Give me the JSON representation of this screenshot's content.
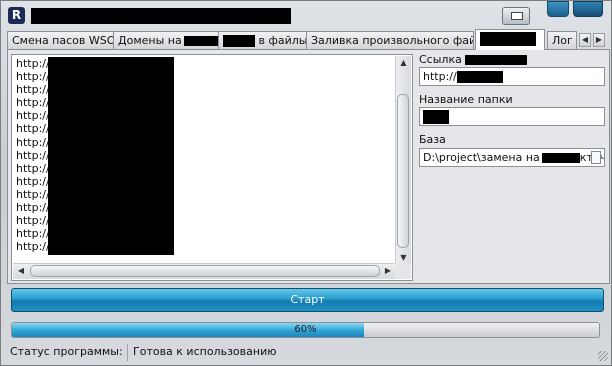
{
  "app": {
    "title": ""
  },
  "tabs": [
    {
      "label": "Смена пасов  WSO"
    },
    {
      "label": "Домены на"
    },
    {
      "label": " в файлы"
    },
    {
      "label": "Заливка произвольного файла"
    },
    {
      "label": ""
    },
    {
      "label": "Лог"
    }
  ],
  "url_list": {
    "lines": [
      "http://",
      "http://",
      "http://",
      "http://",
      "http://",
      "http://",
      "http://",
      "http://",
      "http://",
      "http://",
      "http://",
      "http://",
      "http://",
      "http://",
      "http://"
    ]
  },
  "fields": {
    "link": {
      "label": "Ссылка",
      "value": "http://"
    },
    "folder": {
      "label": "Название папки",
      "value": ""
    },
    "base": {
      "label": "База",
      "value_prefix": "D:\\project\\замена на",
      "value_suffix": "ктач"
    }
  },
  "start_button": {
    "label": "Старт"
  },
  "progress": {
    "value": 0.6,
    "label": "60%"
  },
  "status_bar": {
    "label": "Статус программы:",
    "value": "Готова к использованию"
  },
  "icons": {
    "app": "app-r-icon",
    "restore": "restore-icon",
    "minimize": "minimize-icon",
    "close": "close-icon",
    "file": "file-browse-icon",
    "grip": "resize-grip-icon"
  }
}
